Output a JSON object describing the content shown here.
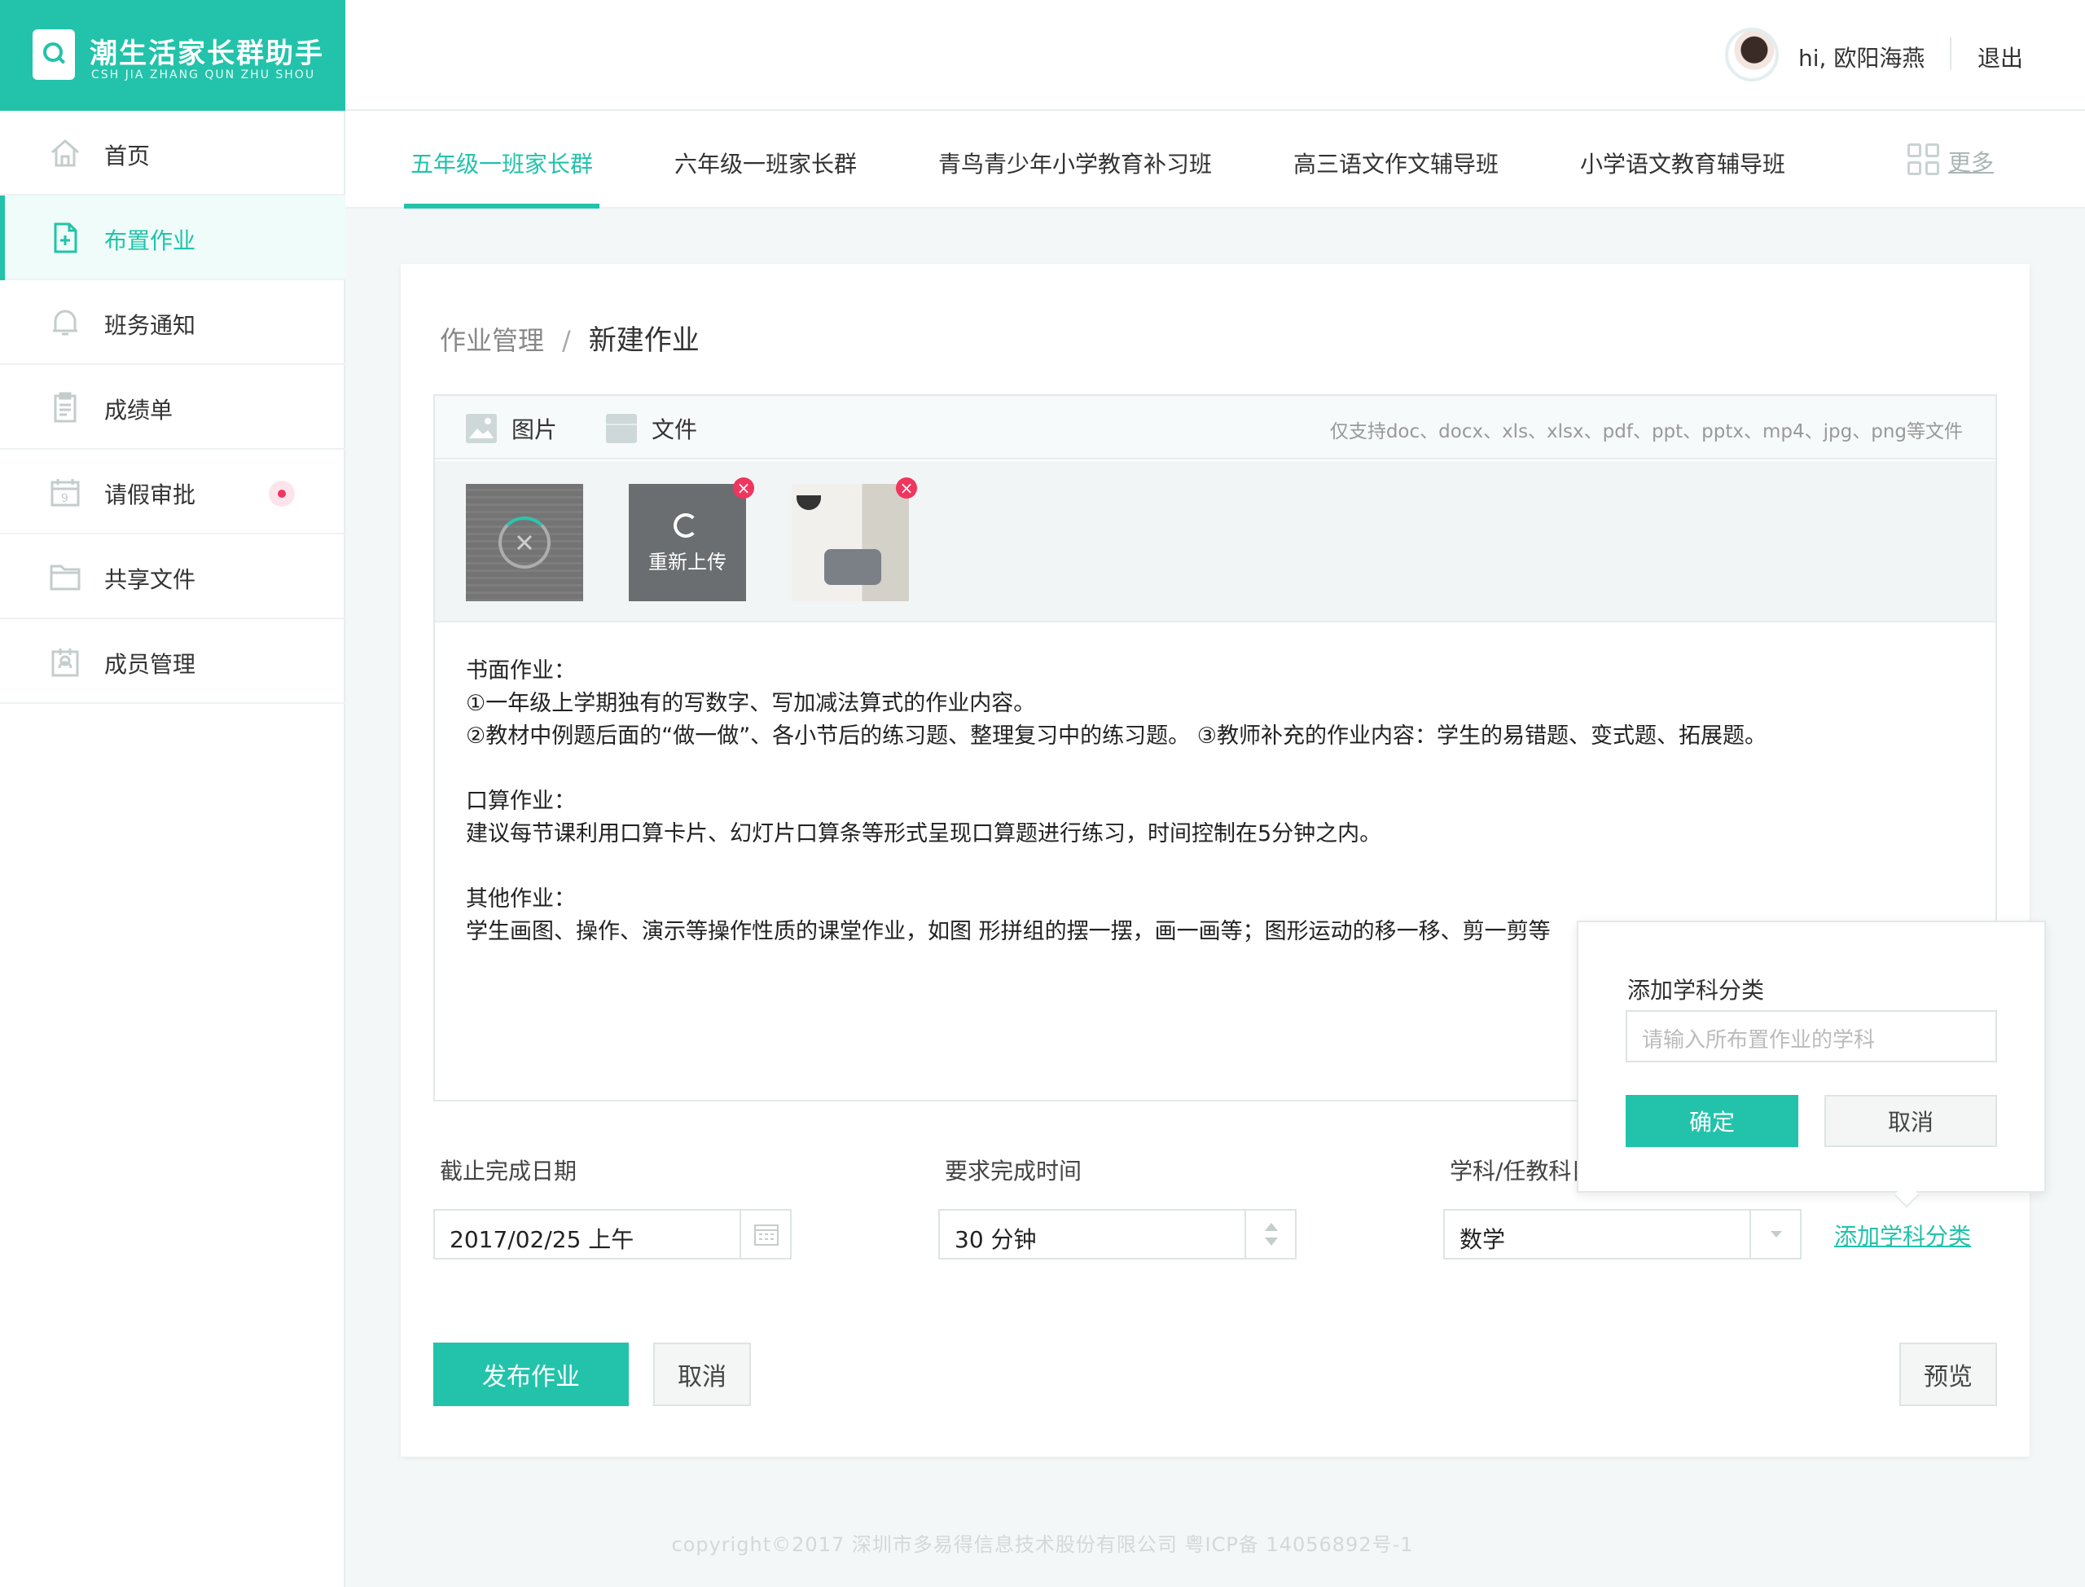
{
  "brand": {
    "title": "潮生活家长群助手",
    "subtitle": "CSH JIA ZHANG QUN ZHU SHOU"
  },
  "header": {
    "greeting": "hi, 欧阳海燕",
    "logout": "退出"
  },
  "sidebar": {
    "items": [
      {
        "label": "首页",
        "icon": "home-icon",
        "active": false
      },
      {
        "label": "布置作业",
        "icon": "add-document-icon",
        "active": true
      },
      {
        "label": "班务通知",
        "icon": "bell-icon",
        "active": false
      },
      {
        "label": "成绩单",
        "icon": "report-icon",
        "active": false
      },
      {
        "label": "请假审批",
        "icon": "calendar-icon",
        "active": false,
        "badge": "dot"
      },
      {
        "label": "共享文件",
        "icon": "folder-icon",
        "active": false
      },
      {
        "label": "成员管理",
        "icon": "members-icon",
        "active": false
      }
    ]
  },
  "tabs": {
    "items": [
      {
        "label": "五年级一班家长群",
        "active": true
      },
      {
        "label": "六年级一班家长群",
        "active": false
      },
      {
        "label": "青鸟青少年小学教育补习班",
        "active": false
      },
      {
        "label": "高三语文作文辅导班",
        "active": false
      },
      {
        "label": "小学语文教育辅导班",
        "active": false
      }
    ],
    "more": "更多"
  },
  "breadcrumb": {
    "parent": "作业管理",
    "separator": "/",
    "current": "新建作业"
  },
  "editor": {
    "toolbar": {
      "image": "图片",
      "file": "文件",
      "support_note": "仅支持doc、docx、xls、xlsx、pdf、ppt、pptx、mp4、jpg、png等文件"
    },
    "reupload_label": "重新上传",
    "lines": [
      "书面作业：",
      "①一年级上学期独有的写数字、写加减法算式的作业内容。",
      "②教材中例题后面的“做一做”、各小节后的练习题、整理复习中的练习题。 ③教师补充的作业内容：学生的易错题、变式题、拓展题。",
      "",
      "口算作业：",
      "建议每节课利用口算卡片、幻灯片口算条等形式呈现口算题进行练习，时间控制在5分钟之内。",
      "",
      "其他作业：",
      "学生画图、操作、演示等操作性质的课堂作业，如图 形拼组的摆一摆，画一画等；图形运动的移一移、剪一剪等"
    ]
  },
  "form": {
    "due_label": "截止完成日期",
    "due_value": "2017/02/25 上午",
    "duration_label": "要求完成时间",
    "duration_value": "30 分钟",
    "subject_label": "学科/任教科目",
    "subject_value": "数学",
    "add_subject": "添加学科分类"
  },
  "popover": {
    "title": "添加学科分类",
    "placeholder": "请输入所布置作业的学科",
    "confirm": "确定",
    "cancel": "取消"
  },
  "actions": {
    "publish": "发布作业",
    "cancel": "取消",
    "preview": "预览"
  },
  "footer": {
    "text": "copyright©2017 深圳市多易得信息技术股份有限公司    粤ICP备 14056892号-1"
  },
  "colors": {
    "accent": "#22c3aa",
    "danger": "#f0355f",
    "background": "#f4f7f7"
  }
}
